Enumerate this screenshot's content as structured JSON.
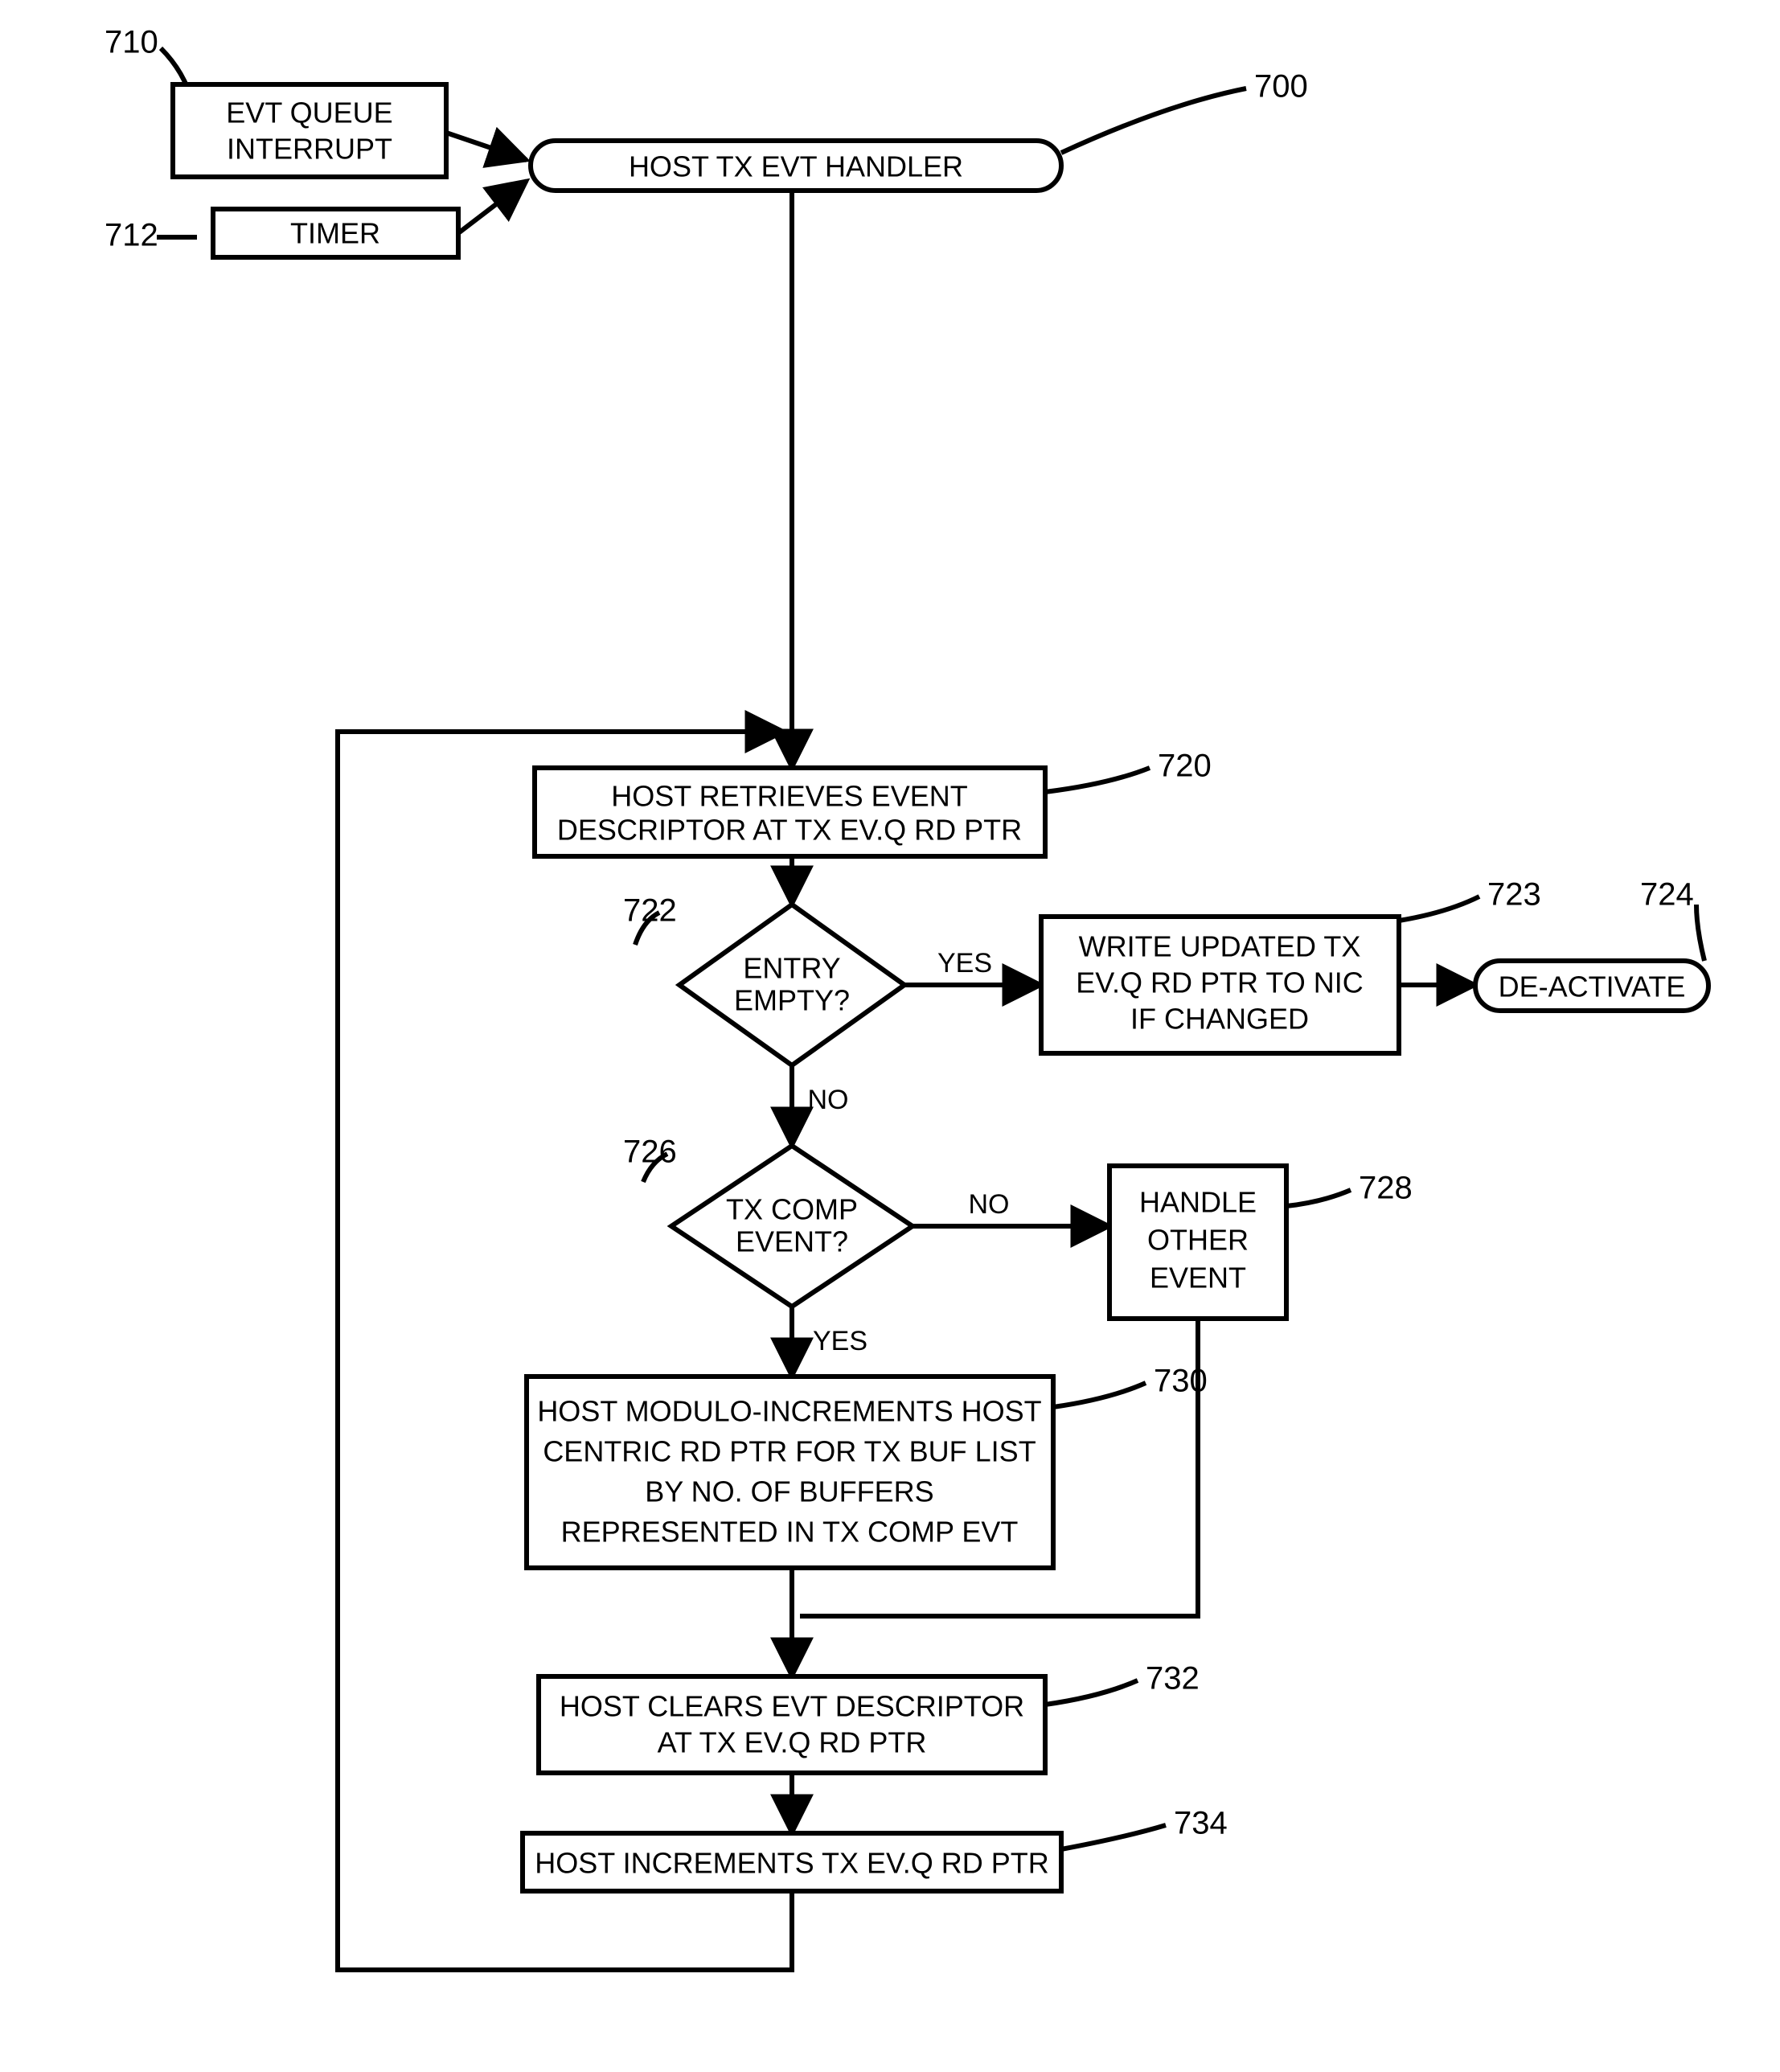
{
  "nodes": {
    "evt_queue_interrupt": {
      "ref": "710",
      "lines": [
        "EVT QUEUE",
        "INTERRUPT"
      ]
    },
    "timer": {
      "ref": "712",
      "lines": [
        "TIMER"
      ]
    },
    "host_tx_evt_handler": {
      "ref": "700",
      "lines": [
        "HOST TX EVT HANDLER"
      ]
    },
    "retrieve_descriptor": {
      "ref": "720",
      "lines": [
        "HOST RETRIEVES EVENT",
        "DESCRIPTOR AT TX EV.Q RD PTR"
      ]
    },
    "entry_empty": {
      "ref": "722",
      "lines": [
        "ENTRY",
        "EMPTY?"
      ]
    },
    "write_updated": {
      "ref": "723",
      "lines": [
        "WRITE UPDATED TX",
        "EV.Q RD PTR TO NIC",
        "IF CHANGED"
      ]
    },
    "deactivate": {
      "ref": "724",
      "lines": [
        "DE-ACTIVATE"
      ]
    },
    "tx_comp_event": {
      "ref": "726",
      "lines": [
        "TX COMP",
        "EVENT?"
      ]
    },
    "handle_other": {
      "ref": "728",
      "lines": [
        "HANDLE",
        "OTHER",
        "EVENT"
      ]
    },
    "modulo_increments": {
      "ref": "730",
      "lines": [
        "HOST MODULO-INCREMENTS HOST",
        "CENTRIC RD PTR FOR TX BUF LIST",
        "BY NO. OF BUFFERS",
        "REPRESENTED IN TX COMP EVT"
      ]
    },
    "clears_descriptor": {
      "ref": "732",
      "lines": [
        "HOST CLEARS EVT DESCRIPTOR",
        "AT TX EV.Q RD PTR"
      ]
    },
    "increments_ptr": {
      "ref": "734",
      "lines": [
        "HOST INCREMENTS TX EV.Q RD PTR"
      ]
    }
  },
  "edge_labels": {
    "yes": "YES",
    "no": "NO"
  }
}
